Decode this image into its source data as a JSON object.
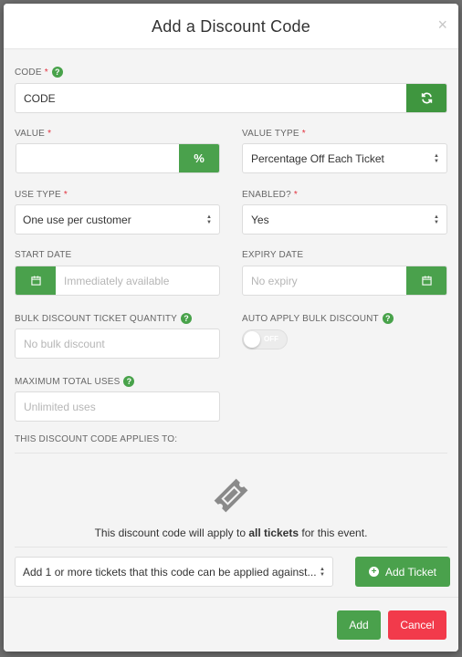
{
  "modal": {
    "title": "Add a Discount Code",
    "close_symbol": "×"
  },
  "code": {
    "label": "CODE",
    "value": "CODE",
    "regenerate_icon": "refresh-icon"
  },
  "value_field": {
    "label": "VALUE",
    "value": "",
    "suffix": "%"
  },
  "value_type": {
    "label": "VALUE TYPE",
    "selected": "Percentage Off Each Ticket"
  },
  "use_type": {
    "label": "USE TYPE",
    "selected": "One use per customer"
  },
  "enabled": {
    "label": "ENABLED?",
    "selected": "Yes"
  },
  "start_date": {
    "label": "START DATE",
    "placeholder": "Immediately available"
  },
  "expiry_date": {
    "label": "EXPIRY DATE",
    "placeholder": "No expiry"
  },
  "bulk_quantity": {
    "label": "BULK DISCOUNT TICKET QUANTITY",
    "placeholder": "No bulk discount"
  },
  "auto_apply": {
    "label": "AUTO APPLY BULK DISCOUNT",
    "toggle_text": "OFF",
    "on": false
  },
  "max_uses": {
    "label": "MAXIMUM TOTAL USES",
    "placeholder": "Unlimited uses"
  },
  "applies": {
    "heading": "THIS DISCOUNT CODE APPLIES TO:",
    "text_before": "This discount code will apply to ",
    "text_bold": "all tickets",
    "text_after": " for this event."
  },
  "ticket_select": {
    "selected": "Add 1 or more tickets that this code can be applied against..."
  },
  "add_ticket_button": {
    "label": "Add Ticket"
  },
  "footer": {
    "add_label": "Add",
    "cancel_label": "Cancel"
  },
  "colors": {
    "green": "#4aa14c",
    "red": "#f23a4b",
    "required": "#e2313e"
  }
}
